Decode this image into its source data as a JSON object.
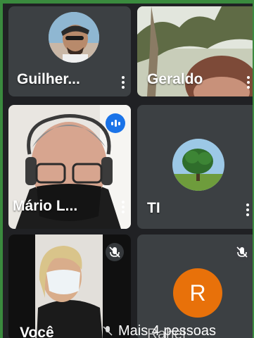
{
  "participants": [
    {
      "name": "Guilher..."
    },
    {
      "name": "Geraldo"
    },
    {
      "name": "Mário L..."
    },
    {
      "name": "TI"
    },
    {
      "name": "Você"
    },
    {
      "name": "Rahel",
      "initial": "R"
    }
  ],
  "footer": {
    "more_people": "Mais 4 pessoas"
  },
  "colors": {
    "accent": "#1a73e8",
    "avatar_r": "#e8710a",
    "tile": "#3c4043",
    "background": "#202124"
  },
  "icons": [
    "more-vert-icon",
    "mic-off-icon",
    "speaking-indicator-icon"
  ]
}
